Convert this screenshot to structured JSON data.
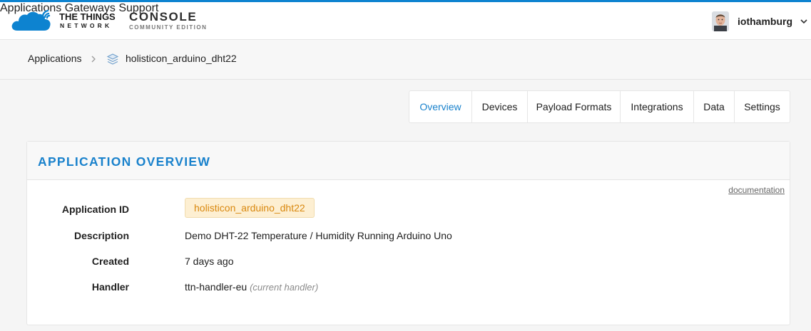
{
  "header": {
    "brand_title": "THE THINGS",
    "brand_sub": "NETWORK",
    "console_title": "CONSOLE",
    "console_sub": "COMMUNITY EDITION",
    "nav": [
      "Applications",
      "Gateways",
      "Support"
    ],
    "username": "iothamburg",
    "accent_color": "#0d83d0"
  },
  "breadcrumbs": {
    "root": "Applications",
    "current": "holisticon_arduino_dht22"
  },
  "tabs": [
    "Overview",
    "Devices",
    "Payload Formats",
    "Integrations",
    "Data",
    "Settings"
  ],
  "active_tab": "Overview",
  "overview": {
    "title": "APPLICATION OVERVIEW",
    "documentation_link": "documentation",
    "fields": {
      "application_id_label": "Application ID",
      "application_id": "holisticon_arduino_dht22",
      "description_label": "Description",
      "description": "Demo DHT-22 Temperature / Humidity Running Arduino Uno",
      "created_label": "Created",
      "created": "7 days ago",
      "handler_label": "Handler",
      "handler": "ttn-handler-eu",
      "handler_note": "(current handler)"
    }
  }
}
